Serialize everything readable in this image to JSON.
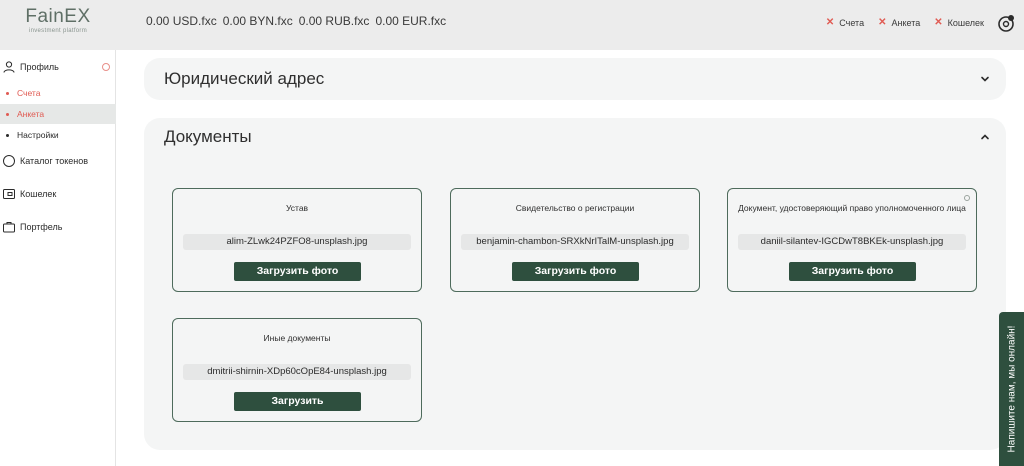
{
  "header": {
    "logo_title": "FainEX",
    "logo_subtitle": "investment platform",
    "balances": [
      "0.00 USD.fxc",
      "0.00 BYN.fxc",
      "0.00 RUB.fxc",
      "0.00 EUR.fxc"
    ],
    "status_items": [
      "Счета",
      "Анкета",
      "Кошелек"
    ],
    "settings_icon": "gear-icon"
  },
  "sidebar": {
    "profile": "Профиль",
    "sub_items": [
      "Счета",
      "Анкета",
      "Настройки"
    ],
    "items": [
      "Каталог токенов",
      "Кошелек",
      "Портфель"
    ]
  },
  "main": {
    "legal_address_title": "Юридический адрес",
    "documents_title": "Документы",
    "documents": [
      {
        "label": "Устав",
        "file": "alim-ZLwk24PZFO8-unsplash.jpg",
        "button": "Загрузить фото"
      },
      {
        "label": "Свидетельство о регистрации",
        "file": "benjamin-chambon-SRXkNrITalM-unsplash.jpg",
        "button": "Загрузить фото"
      },
      {
        "label": "Документ, удостоверяющий право уполномоченного лица",
        "file": "daniil-silantev-IGCDwT8BKEk-unsplash.jpg",
        "button": "Загрузить фото"
      },
      {
        "label": "Иные документы",
        "file": "dmitrii-shirnin-XDp60cOpE84-unsplash.jpg",
        "button": "Загрузить"
      }
    ]
  },
  "chat": {
    "label": "Напишите нам, мы онлайн!"
  },
  "colors": {
    "accent": "#2e4f3e",
    "alert": "#e05a52",
    "panel": "#f4f5f5"
  }
}
